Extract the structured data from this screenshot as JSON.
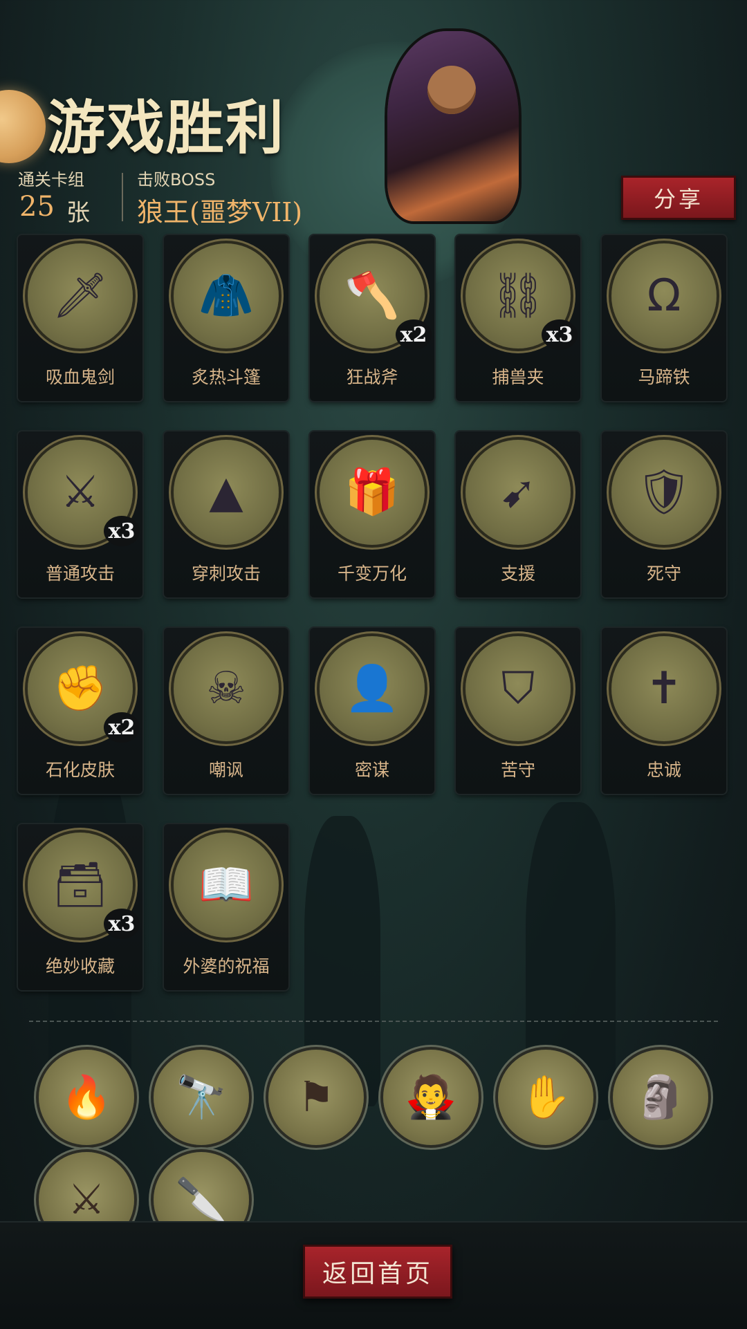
{
  "header": {
    "title": "游戏胜利",
    "stage_label": "通关卡组",
    "card_count": "25",
    "card_unit": "张",
    "boss_label": "击败BOSS",
    "boss_name": "狼王(噩梦VII)",
    "share_label": "分享"
  },
  "cards": [
    {
      "name": "吸血鬼剑",
      "icon": "vampire-sword-icon",
      "glyph": "🗡",
      "count": ""
    },
    {
      "name": "炙热斗篷",
      "icon": "red-cloak-icon",
      "glyph": "🧥",
      "count": ""
    },
    {
      "name": "狂战斧",
      "icon": "berserker-axe-icon",
      "glyph": "🪓",
      "count": "x2"
    },
    {
      "name": "捕兽夹",
      "icon": "bear-trap-icon",
      "glyph": "⛓",
      "count": "x3"
    },
    {
      "name": "马蹄铁",
      "icon": "horseshoe-icon",
      "glyph": "Ω",
      "count": ""
    },
    {
      "name": "普通攻击",
      "icon": "sword-strike-icon",
      "glyph": "⚔",
      "count": "x3"
    },
    {
      "name": "穿刺攻击",
      "icon": "spike-attack-icon",
      "glyph": "▲",
      "count": ""
    },
    {
      "name": "千变万化",
      "icon": "jack-in-box-icon",
      "glyph": "🎁",
      "count": ""
    },
    {
      "name": "支援",
      "icon": "support-arrows-icon",
      "glyph": "➹",
      "count": ""
    },
    {
      "name": "死守",
      "icon": "defender-icon",
      "glyph": "🛡",
      "count": ""
    },
    {
      "name": "石化皮肤",
      "icon": "stone-fist-icon",
      "glyph": "✊",
      "count": "x2"
    },
    {
      "name": "嘲讽",
      "icon": "taunt-icon",
      "glyph": "☠",
      "count": ""
    },
    {
      "name": "密谋",
      "icon": "hooded-conspirators-icon",
      "glyph": "👤",
      "count": ""
    },
    {
      "name": "苦守",
      "icon": "wooden-shield-icon",
      "glyph": "⛉",
      "count": ""
    },
    {
      "name": "忠诚",
      "icon": "holy-cross-icon",
      "glyph": "✝",
      "count": ""
    },
    {
      "name": "绝妙收藏",
      "icon": "collection-icon",
      "glyph": "🗃",
      "count": "x3"
    },
    {
      "name": "外婆的祝福",
      "icon": "grandma-book-icon",
      "glyph": "📖",
      "count": ""
    }
  ],
  "relics": [
    {
      "icon": "fire-goblin-icon",
      "glyph": "🔥"
    },
    {
      "icon": "spyglass-icon",
      "glyph": "🔭"
    },
    {
      "icon": "pirate-flag-icon",
      "glyph": "⚑"
    },
    {
      "icon": "vampire-icon",
      "glyph": "🧛"
    },
    {
      "icon": "magic-hand-icon",
      "glyph": "✋"
    },
    {
      "icon": "gargoyle-statue-icon",
      "glyph": "🗿"
    },
    {
      "icon": "claw-blades-icon",
      "glyph": "⚔"
    },
    {
      "icon": "mad-chef-icon",
      "glyph": "🔪"
    }
  ],
  "footer": {
    "home_label": "返回首页"
  },
  "colors": {
    "accent_gold": "#f0b46a",
    "button_red": "#a9242a",
    "card_text": "#d8b58a"
  }
}
